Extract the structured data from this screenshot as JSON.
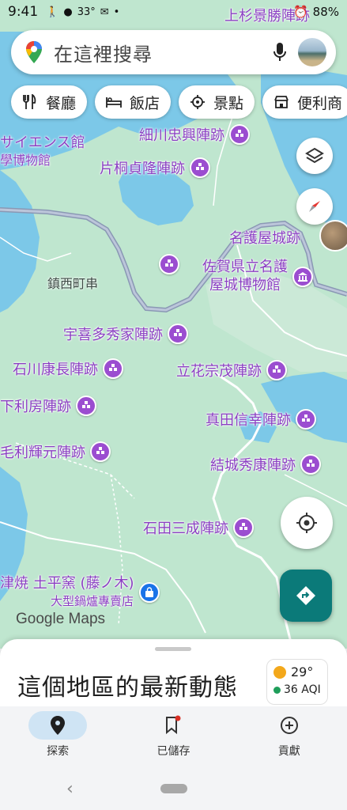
{
  "status_bar": {
    "time": "9:41",
    "temperature": "33°",
    "battery": "88%"
  },
  "search": {
    "placeholder": "在這裡搜尋"
  },
  "chips": [
    {
      "label": "餐廳",
      "icon": "restaurant-icon"
    },
    {
      "label": "飯店",
      "icon": "hotel-icon"
    },
    {
      "label": "景點",
      "icon": "attraction-icon"
    },
    {
      "label": "便利商",
      "icon": "store-icon"
    }
  ],
  "map": {
    "pois": {
      "uesugi": "上杉景勝陣跡",
      "hosokawa": "細川忠興陣跡",
      "katagiri": "片桐貞隆陣跡",
      "nagoya_castle": "名護屋城跡",
      "museum_line1": "佐賀県立名護",
      "museum_line2": "屋城博物館",
      "ukita": "宇喜多秀家陣跡",
      "ishikawa": "石川康長陣跡",
      "tachibana": "立花宗茂陣跡",
      "kinoshita": "下利房陣跡",
      "sanada": "真田信幸陣跡",
      "mori": "毛利輝元陣跡",
      "yuki": "結城秀康陣跡",
      "ishida": "石田三成陣跡",
      "kiln": "津焼 土平窯 (藤ノ木)",
      "kiln_sub": "大型鍋爐專賣店",
      "science_line1": "サイエンス館",
      "science_line2": "學博物館"
    },
    "town": "鎮西町串",
    "attribution": "Google Maps"
  },
  "sheet": {
    "title": "這個地區的最新動態",
    "weather_temp": "29°",
    "aqi": "36 AQI"
  },
  "nav": {
    "explore": "探索",
    "saved": "已儲存",
    "contribute": "貢獻"
  },
  "colors": {
    "map_land": "#bfe6cf",
    "water": "#7cc8e8",
    "poi_purple": "#9b4dd0",
    "directions_teal": "#0b7a79",
    "nav_active": "#cfe4f4"
  }
}
